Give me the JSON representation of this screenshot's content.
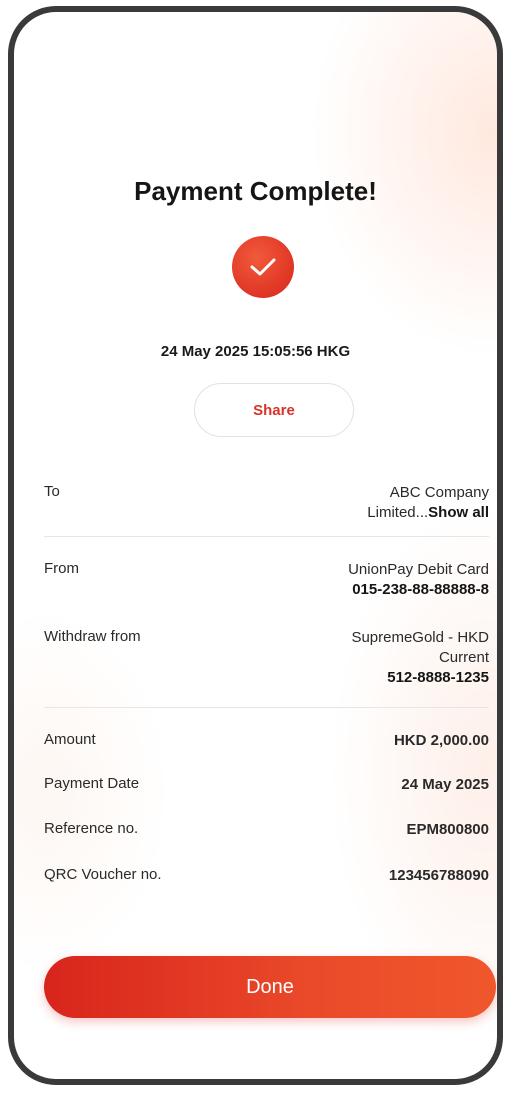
{
  "header": {
    "title": "Payment Complete!"
  },
  "status": {
    "timestamp": "24 May 2025 15:05:56 HKG"
  },
  "actions": {
    "share_label": "Share",
    "done_label": "Done"
  },
  "details": {
    "to": {
      "label": "To",
      "value_line1": "ABC Company",
      "value_line2": "Limited...",
      "show_all": "Show all"
    },
    "from": {
      "label": "From",
      "value_line1": "UnionPay Debit Card",
      "value_line2": "015-238-88-88888-8"
    },
    "withdraw": {
      "label": "Withdraw from",
      "value_line1": "SupremeGold - HKD",
      "value_line2": "Current",
      "value_line3": "512-8888-1235"
    },
    "amount": {
      "label": "Amount",
      "value": "HKD 2,000.00"
    },
    "payment_date": {
      "label": "Payment Date",
      "value": "24 May 2025"
    },
    "reference": {
      "label": "Reference no.",
      "value": "EPM800800"
    },
    "voucher": {
      "label": "QRC Voucher no.",
      "value": "123456788090"
    }
  },
  "icons": {
    "success": "checkmark-icon"
  },
  "colors": {
    "accent": "#d9332a",
    "frame": "#3a3a3a"
  }
}
